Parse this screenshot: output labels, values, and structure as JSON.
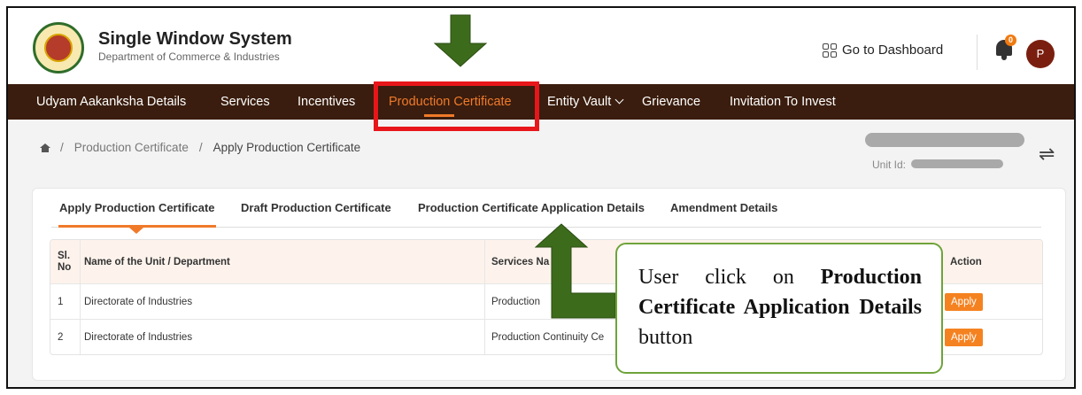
{
  "header": {
    "title": "Single Window System",
    "subtitle": "Department of Commerce & Industries",
    "dashboard_link": "Go to Dashboard",
    "notification_count": "0",
    "avatar_initial": "P"
  },
  "nav": {
    "items": [
      {
        "label": "Udyam Aakanksha Details"
      },
      {
        "label": "Services"
      },
      {
        "label": "Incentives"
      },
      {
        "label": "Production Certificate",
        "active": true
      },
      {
        "label": "Entity Vault"
      },
      {
        "label": "Grievance"
      },
      {
        "label": "Invitation To Invest"
      }
    ]
  },
  "breadcrumb": {
    "separator": "/",
    "items": [
      "Production Certificate",
      "Apply Production Certificate"
    ]
  },
  "unit": {
    "label": "Unit Id:"
  },
  "tabs": [
    {
      "label": "Apply Production Certificate",
      "active": true
    },
    {
      "label": "Draft Production Certificate"
    },
    {
      "label": "Production Certificate Application Details"
    },
    {
      "label": "Amendment Details"
    }
  ],
  "table": {
    "columns": [
      "Sl. No",
      "Name of the Unit / Department",
      "Services Na",
      "Action"
    ],
    "rows": [
      {
        "sl": "1",
        "unit": "Directorate of Industries",
        "service": "Production",
        "action": "Apply"
      },
      {
        "sl": "2",
        "unit": "Directorate of Industries",
        "service": "Production Continuity Ce",
        "action": "Apply"
      }
    ]
  },
  "annotation": {
    "prefix": "User click on ",
    "bold": "Production Certificate Application Details",
    "suffix": " button"
  },
  "colors": {
    "nav_bg": "#3a1d0e",
    "accent": "#f07a2a",
    "highlight_box": "#e8161a",
    "arrow_green": "#3d6b1c"
  }
}
